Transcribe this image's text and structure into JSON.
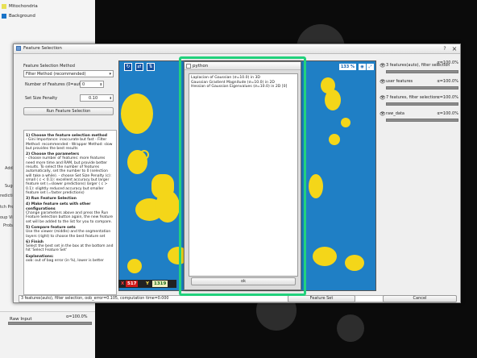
{
  "background_layers": {
    "items": [
      {
        "label": "Mitochondria",
        "color": "#e8e055"
      },
      {
        "label": "Background",
        "color": "#1a73c7"
      }
    ],
    "raw_input": {
      "label": "Raw Input",
      "alpha": "α=100.0%"
    },
    "peek_texts": [
      "Add",
      "Sugg",
      "rediction",
      "oup Visi",
      "Probab",
      "tch Proc"
    ]
  },
  "dialog": {
    "title": "Feature Selection",
    "help_btn": "?",
    "close_btn": "×"
  },
  "left_panel": {
    "method_label": "Feature Selection Method",
    "method_value": "Filter Method (recommended)",
    "num_features_label": "Number of Features (0=auto)",
    "num_features_value": "0",
    "size_penalty_label": "Set Size Penalty",
    "size_penalty_value": "0.10",
    "run_button": "Run Feature Selection",
    "help": [
      {
        "h": "1) Choose the feature selection method",
        "p": "- Gini Importance: inaccurate but fast - Filter Method: recommended - Wrapper Method: slow but provides the best results"
      },
      {
        "h": "2) Choose the parameters",
        "p": "- choose number of features: more features need more time and RAM, but provide better results. To select the number of features automatically, set the number to 0 (selection will take a while). - choose Set Size Penalty (c): small ( c < 0.1): excellent accuracy but larger feature set (=slower predictions) larger ( c > 0.1): slightly reduced accuracy but smaller feature set (=faster predictions)"
      },
      {
        "h": "3) Run Feature Selection",
        "p": ""
      },
      {
        "h": "4) Make feature sets with other configurations",
        "p": "Change parameters above and press the Run Feature Selection button again, the new feature set will be added to the list for you to compare."
      },
      {
        "h": "5) Compare feature sets",
        "p": "Use the viewer (middle) and the segmentation layers (right) to choose the best feature set"
      },
      {
        "h": "6) Finish",
        "p": "Select the best set in the box at the bottom and hit 'Select Feature Set'"
      },
      {
        "h": "Explanations:",
        "p": "oob: out of bag error (in %), lower is better"
      }
    ]
  },
  "viewer": {
    "zoom": "133 %",
    "coord_x_label": "X",
    "coord_x": "517",
    "coord_y_label": "Y",
    "coord_y": "1319"
  },
  "right_panel": {
    "layers": [
      {
        "name": "3 features(auto), filter selection",
        "alpha": "α=100.0%"
      },
      {
        "name": "user features",
        "alpha": "α=100.0%"
      },
      {
        "name": "7 features, filter selection",
        "alpha": "α=100.0%"
      },
      {
        "name": "raw_data",
        "alpha": "α=100.0%"
      }
    ]
  },
  "bottom": {
    "status": "3 features(auto), filter selection, oob_error=0.105, computation time=0.000",
    "select_set_button": "Feature Set",
    "cancel_button": "Cancel"
  },
  "python_popup": {
    "title": "python",
    "lines": [
      "Laplacian of Gaussian (σ=10.0) in 3D",
      "Gaussian Gradient Magnitude (σ=10.0) in 2D",
      "Hessian of Gaussian Eigenvalues (σ=10.0) in 2D [0]"
    ],
    "ok_button": "ok"
  },
  "colors": {
    "highlight": "#22d17c",
    "viewer_bg": "#1f7fc5",
    "blob": "#f4d619"
  }
}
